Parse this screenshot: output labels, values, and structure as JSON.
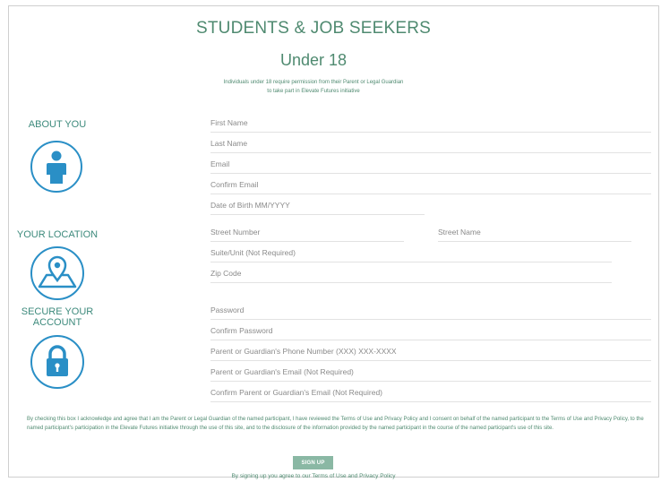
{
  "header": {
    "title": "STUDENTS & JOB SEEKERS",
    "subtitle": "Under 18",
    "note_line1": "Individuals under 18 require permission from their Parent or Legal Guardian",
    "note_line2": "to take part in Elevate Futures initiative"
  },
  "sections": {
    "about": {
      "label": "ABOUT YOU",
      "icon": "person-icon"
    },
    "location": {
      "label": "YOUR LOCATION",
      "icon": "map-pin-icon"
    },
    "account": {
      "label_line1": "SECURE YOUR",
      "label_line2": "ACCOUNT",
      "icon": "lock-icon"
    }
  },
  "fields": {
    "first_name": "First Name",
    "last_name": "Last Name",
    "email": "Email",
    "confirm_email": "Confirm Email",
    "dob": "Date of Birth MM/YYYY",
    "street_number": "Street Number",
    "street_name": "Street Name",
    "suite": "Suite/Unit (Not Required)",
    "zip": "Zip Code",
    "password": "Password",
    "confirm_password": "Confirm Password",
    "guardian_phone": "Parent or Guardian's Phone Number (XXX) XXX-XXXX",
    "guardian_email": "Parent or Guardian's Email (Not Required)",
    "confirm_guardian_email": "Confirm Parent or Guardian's Email (Not Required)"
  },
  "consent_text": "By checking this box I acknowledge and agree that I am the Parent or Legal Guardian of the named participant, I have reviewed the Terms of Use and Privacy Policy and I consent on behalf of the named participant to the Terms of Use and Privacy Policy, to the named participant's participation in the Elevate Futures initiative through the use of this site, and to the disclosure of the information provided by the named participant in the course of the named participant's use of this site.",
  "signup": {
    "button_label": "SIGN UP",
    "terms_prefix": "By signing up you agree to our ",
    "terms_link": "Terms of Use",
    "terms_and": " and ",
    "privacy_link": "Privacy Policy"
  },
  "colors": {
    "brand_green": "#4f8a70",
    "icon_blue": "#2a8fc6",
    "button_green": "#8ab8a4"
  }
}
